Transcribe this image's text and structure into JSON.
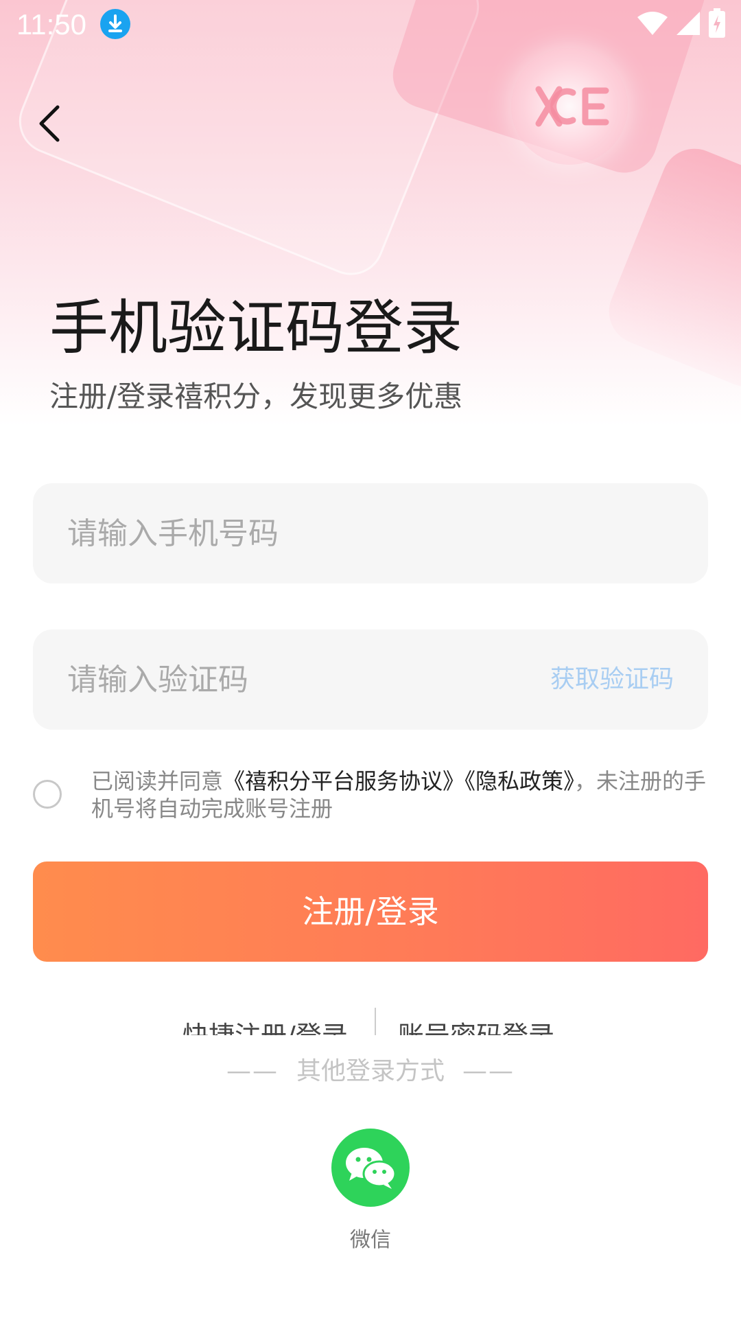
{
  "status_bar": {
    "time": "11:50",
    "icons": [
      "download-icon",
      "wifi-icon",
      "signal-icon",
      "battery-charging-icon"
    ]
  },
  "header": {
    "back_icon": "chevron-left-icon",
    "title": "手机验证码登录",
    "subtitle": "注册/登录禧积分，发现更多优惠"
  },
  "form": {
    "phone_placeholder": "请输入手机号码",
    "phone_value": "",
    "code_placeholder": "请输入验证码",
    "code_value": "",
    "get_code_label": "获取验证码",
    "agreement": {
      "checked": false,
      "prefix": "已阅读并同意",
      "service_link": "《禧积分平台服务协议》",
      "privacy_link": "《隐私政策》",
      "suffix": "，未注册的手机号将自动完成账号注册"
    },
    "submit_label": "注册/登录"
  },
  "alt_login": {
    "quick_label": "快捷注册/登录",
    "password_label": "账号密码登录",
    "other_dash_left": "——",
    "other_label": "其他登录方式",
    "other_dash_right": "——",
    "wechat_icon": "wechat-icon",
    "wechat_label": "微信"
  },
  "colors": {
    "accent_start": "#ff8c4d",
    "accent_end": "#ff6a62",
    "link_blue": "#a8cdf2",
    "wechat_green": "#2ed35a",
    "hero_pink": "#fbc6d1"
  }
}
